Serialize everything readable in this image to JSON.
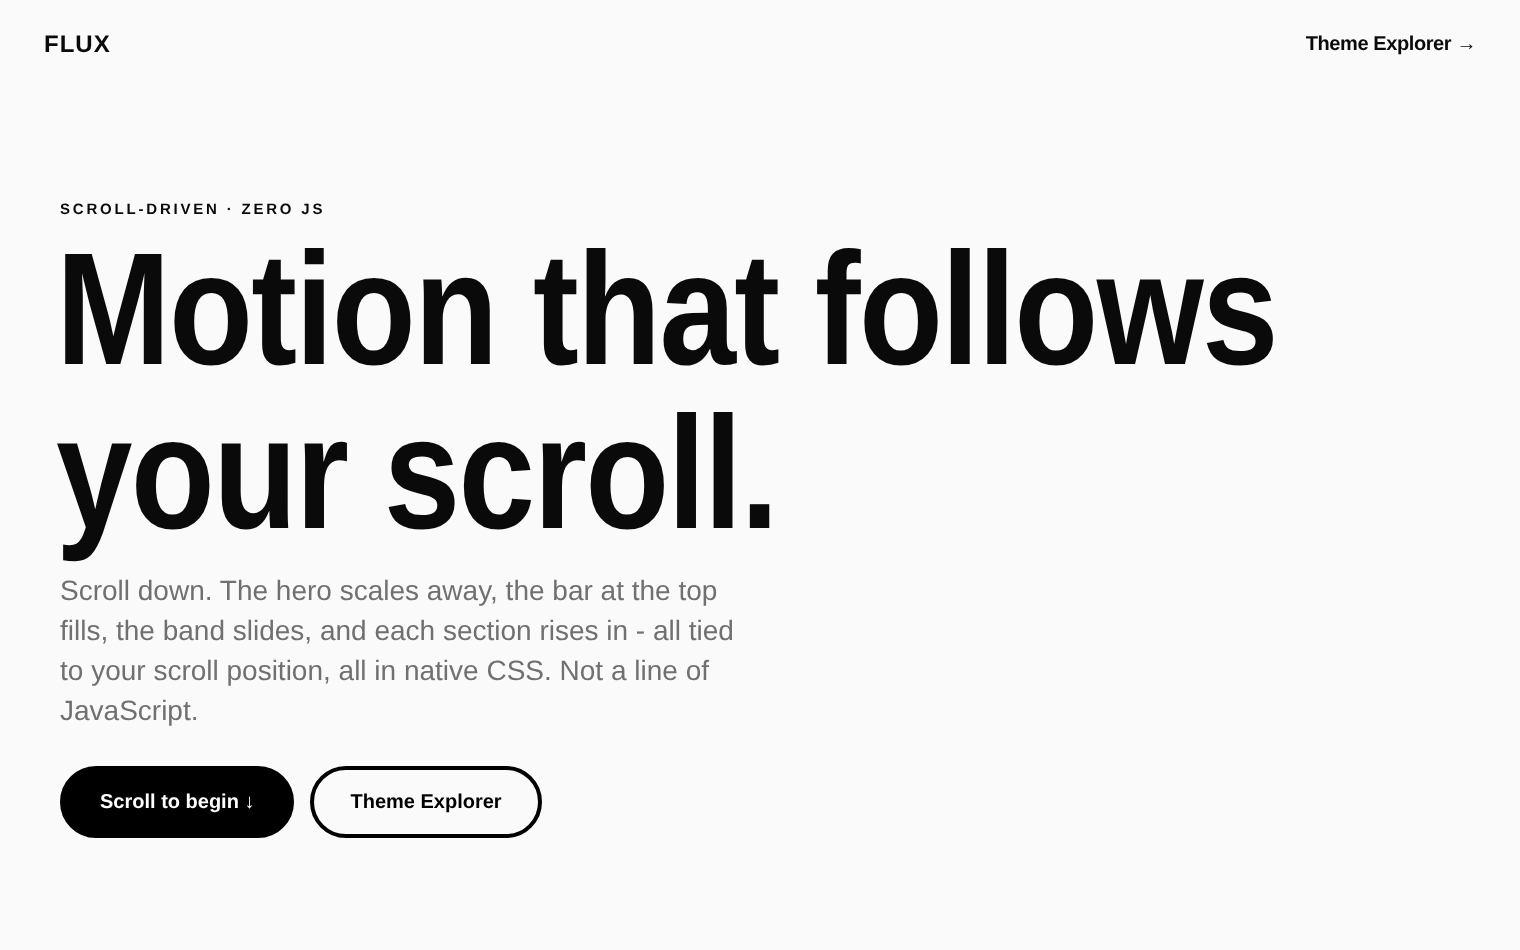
{
  "header": {
    "logo": "FLUX",
    "nav_link": "Theme Explorer →"
  },
  "hero": {
    "eyebrow": "SCROLL-DRIVEN · ZERO JS",
    "headline": [
      "Motion that follows",
      "your scroll."
    ],
    "description": "Scroll down. The hero scales away, the bar at the top fills, the band slides, and each section rises in - all tied to your scroll position, all in native CSS. Not a line of JavaScript.",
    "buttons": [
      {
        "label": "Scroll to begin ↓",
        "kind": "primary"
      },
      {
        "label": "Theme Explorer",
        "kind": "secondary"
      }
    ]
  }
}
